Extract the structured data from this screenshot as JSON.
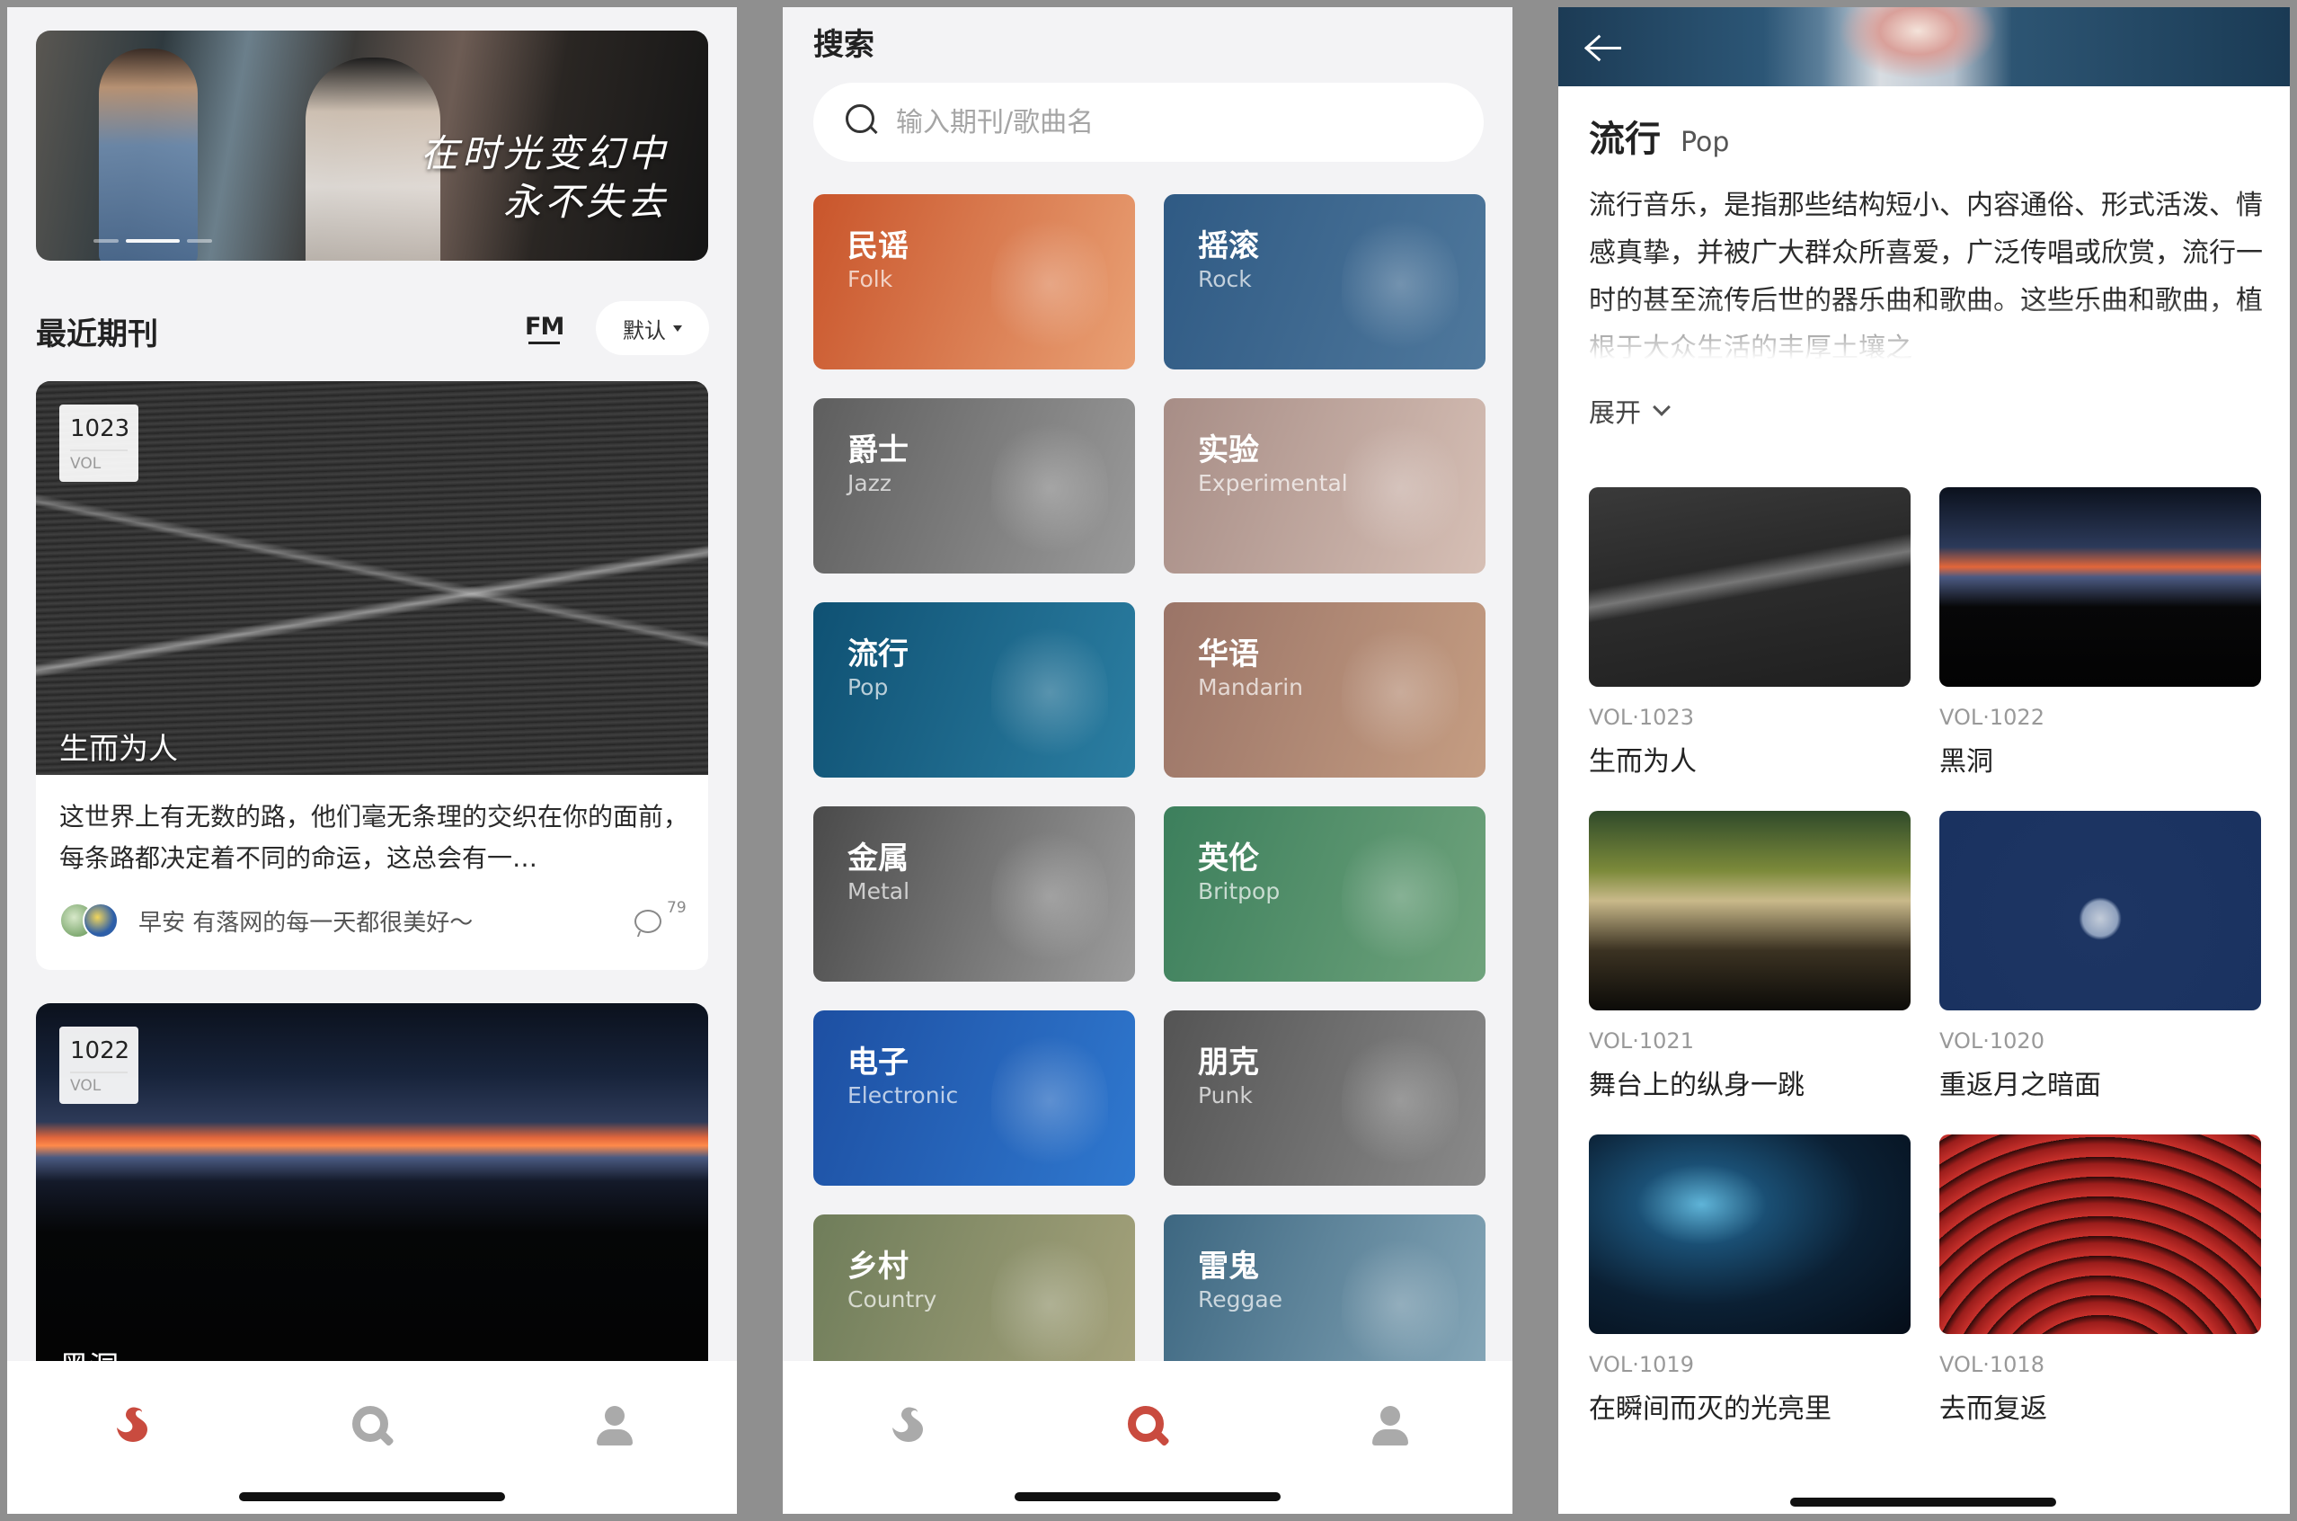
{
  "screen1": {
    "banner": {
      "calligraphy_line1": "在时光变幻中",
      "calligraphy_line2": "永不失去"
    },
    "section_title": "最近期刊",
    "fm_label": "FM",
    "sort_label": "默认",
    "cards": [
      {
        "vol_number": "1023",
        "vol_label": "VOL",
        "title": "生而为人",
        "description": "这世界上有无数的路，他们毫无条理的交织在你的面前，每条路都决定着不同的命运，这总会有一…",
        "meta_text": "早安 有落网的每一天都很美好～",
        "comment_count": "79"
      },
      {
        "vol_number": "1022",
        "vol_label": "VOL",
        "title": "黑洞"
      }
    ]
  },
  "screen2": {
    "title": "搜索",
    "search_placeholder": "输入期刊/歌曲名",
    "genres": [
      {
        "zh": "民谣",
        "en": "Folk",
        "c1": "#c9552b",
        "c2": "#e9a074"
      },
      {
        "zh": "摇滚",
        "en": "Rock",
        "c1": "#2f5a84",
        "c2": "#4f789c"
      },
      {
        "zh": "爵士",
        "en": "Jazz",
        "c1": "#5e5e5e",
        "c2": "#9a9a9a"
      },
      {
        "zh": "实验",
        "en": "Experimental",
        "c1": "#a78d86",
        "c2": "#d6bfb5"
      },
      {
        "zh": "流行",
        "en": "Pop",
        "c1": "#0f5173",
        "c2": "#2b7ea2"
      },
      {
        "zh": "华语",
        "en": "Mandarin",
        "c1": "#9a7467",
        "c2": "#c59d82"
      },
      {
        "zh": "金属",
        "en": "Metal",
        "c1": "#4a4a4a",
        "c2": "#9c9c9c"
      },
      {
        "zh": "英伦",
        "en": "Britpop",
        "c1": "#3c7f5c",
        "c2": "#6fa37c"
      },
      {
        "zh": "电子",
        "en": "Electronic",
        "c1": "#1d4fa2",
        "c2": "#2f78cf"
      },
      {
        "zh": "朋克",
        "en": "Punk",
        "c1": "#545454",
        "c2": "#8a8a8a"
      },
      {
        "zh": "乡村",
        "en": "Country",
        "c1": "#6f7d5a",
        "c2": "#a6a37c"
      },
      {
        "zh": "雷鬼",
        "en": "Reggae",
        "c1": "#3d6781",
        "c2": "#86a7b8"
      }
    ]
  },
  "screen3": {
    "title_zh": "流行",
    "title_en": "Pop",
    "description": "流行音乐，是指那些结构短小、内容通俗、形式活泼、情感真挚，并被广大群众所喜爱，广泛传唱或欣赏，流行一时的甚至流传后世的器乐曲和歌曲。这些乐曲和歌曲，植根于大众生活的丰厚土壤之",
    "expand_label": "展开",
    "vols": [
      {
        "vol": "VOL·1023",
        "title": "生而为人",
        "bg": "linear-gradient(170deg, #3a3a3a 0%, #2a2a2a 40%, #777 47%, #2b2b2b 53%, #1f1f1f 100%)"
      },
      {
        "vol": "VOL·1022",
        "title": "黑洞",
        "bg": "linear-gradient(180deg, #0b111d 0%, #2c3a5a 30%, #e3663a 40%, #4b5a83 45%, #070708 60%, #030303 100%)"
      },
      {
        "vol": "VOL·1021",
        "title": "舞台上的纵身一跳",
        "bg": "linear-gradient(180deg, #2f4a2a 0%, #7c8a3a 30%, #c9b98a 45%, #3b3222 70%, #0c0b08 100%)"
      },
      {
        "vol": "VOL·1020",
        "title": "重返月之暗面",
        "bg": "radial-gradient(circle at 50% 54%, #c3ccd9 0%, #8ea0bd 9%, #1d3563 11%, #1a3260 100%)"
      },
      {
        "vol": "VOL·1019",
        "title": "在瞬间而灭的光亮里",
        "bg": "radial-gradient(ellipse at 35% 35%, #5fb4d8 0%, #1a4f74 22%, #0b2034 55%, #050d18 100%)"
      },
      {
        "vol": "VOL·1018",
        "title": "去而复返",
        "bg": "repeating-radial-gradient(circle at 50% 140%, #c8302b 0px, #9a1d1b 14px, #2a0b0a 22px), #110606"
      }
    ]
  }
}
